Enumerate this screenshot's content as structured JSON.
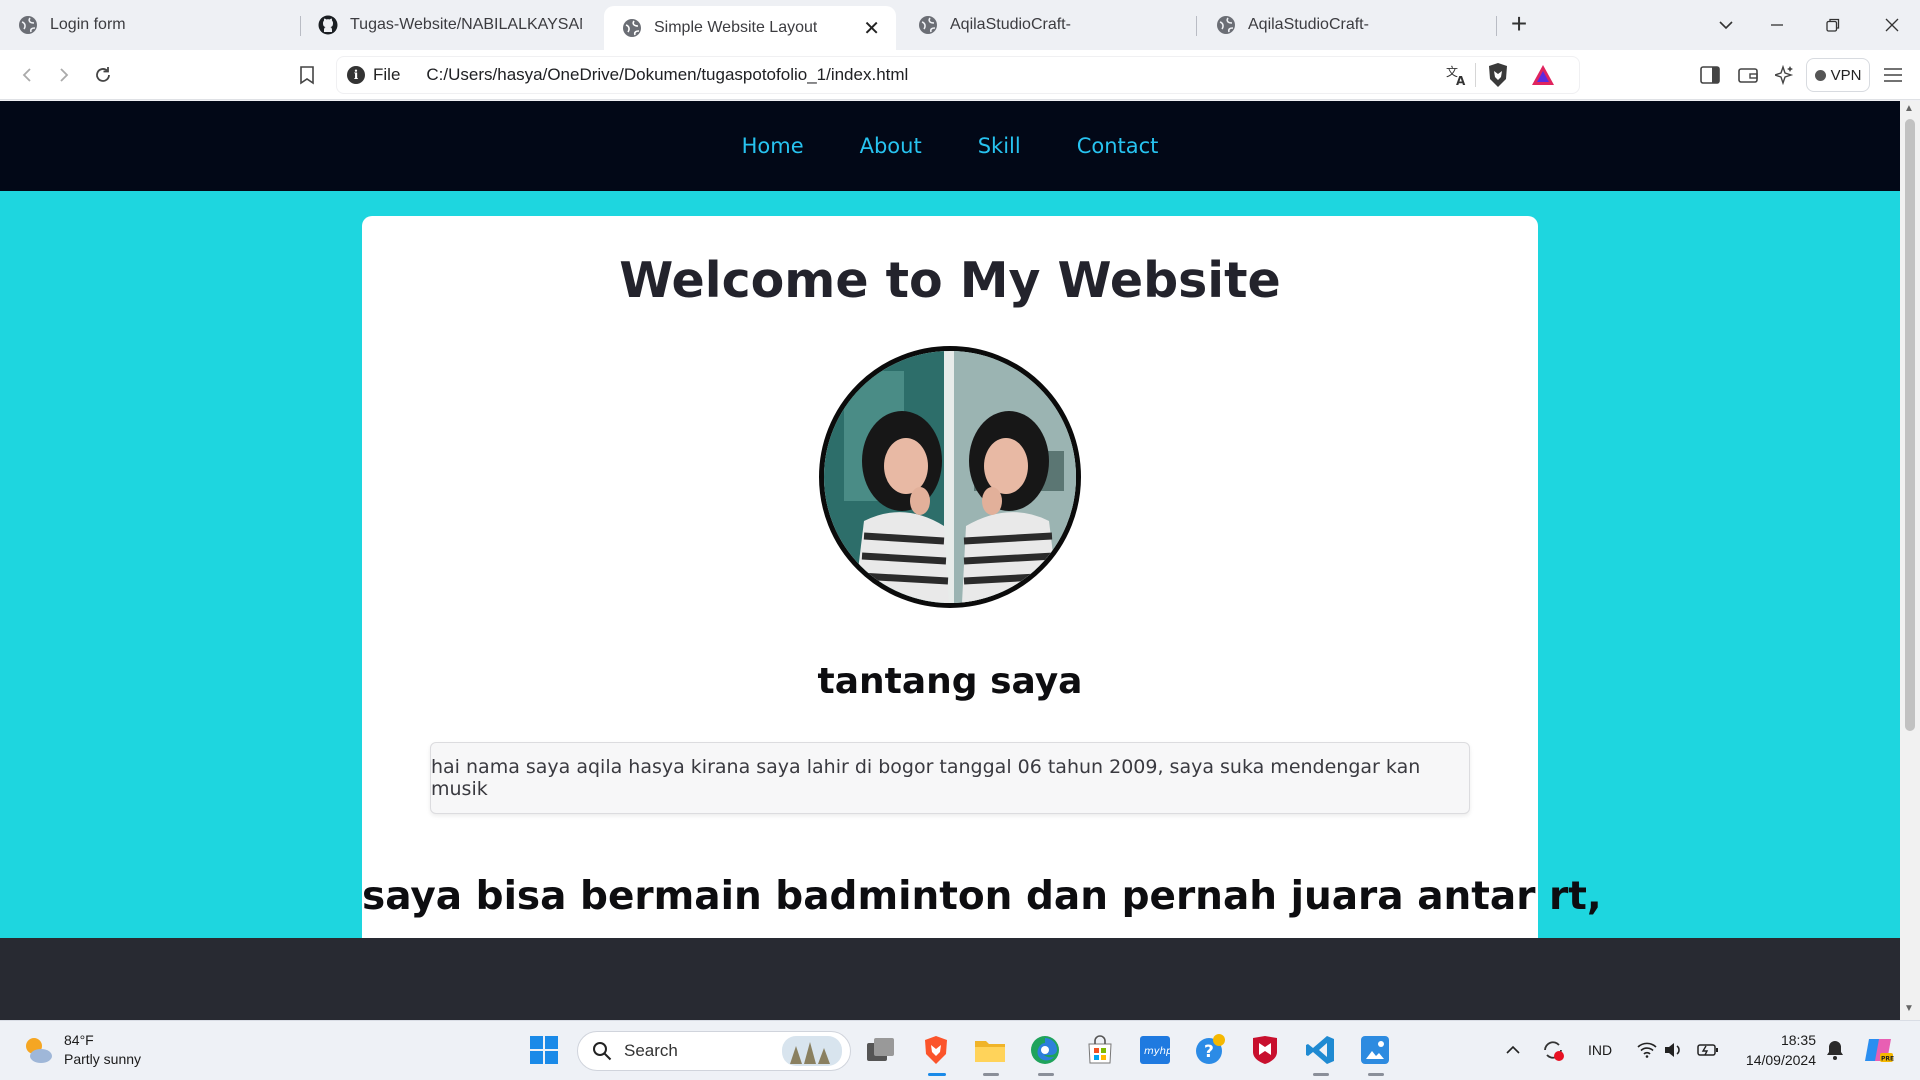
{
  "browser": {
    "tabs": [
      {
        "title": "Login form",
        "icon": "globe-icon",
        "active": false
      },
      {
        "title": "Tugas-Website/NABILALKAYSAN.jpg",
        "icon": "github-icon",
        "active": false
      },
      {
        "title": "Simple Website Layout",
        "icon": "globe-icon",
        "active": true
      },
      {
        "title": "AqilaStudioCraft-",
        "icon": "globe-icon",
        "active": false
      },
      {
        "title": "AqilaStudioCraft-",
        "icon": "globe-icon",
        "active": false
      }
    ],
    "new_tab_label": "+",
    "address": {
      "scheme_label": "File",
      "url": "C:/Users/hasya/OneDrive/Dokumen/tugaspotofolio_1/index.html"
    },
    "vpn_label": "VPN"
  },
  "page": {
    "nav": [
      "Home",
      "About",
      "Skill",
      "Contact"
    ],
    "title": "Welcome to My Website",
    "about_heading": "tantang saya",
    "about_text": "hai nama saya aqila hasya kirana saya lahir di bogor tanggal 06 tahun 2009, saya suka mendengar kan musik",
    "skill_heading": "saya bisa bermain badminton dan pernah juara antar rt,"
  },
  "taskbar": {
    "weather_temp": "84°F",
    "weather_desc": "Partly sunny",
    "search_label": "Search",
    "language": "IND",
    "time": "18:35",
    "date": "14/09/2024"
  },
  "colors": {
    "page_background": "#1ed6df",
    "nav_background": "#020817",
    "nav_link": "#27c3f0",
    "footer": "#282a32"
  }
}
